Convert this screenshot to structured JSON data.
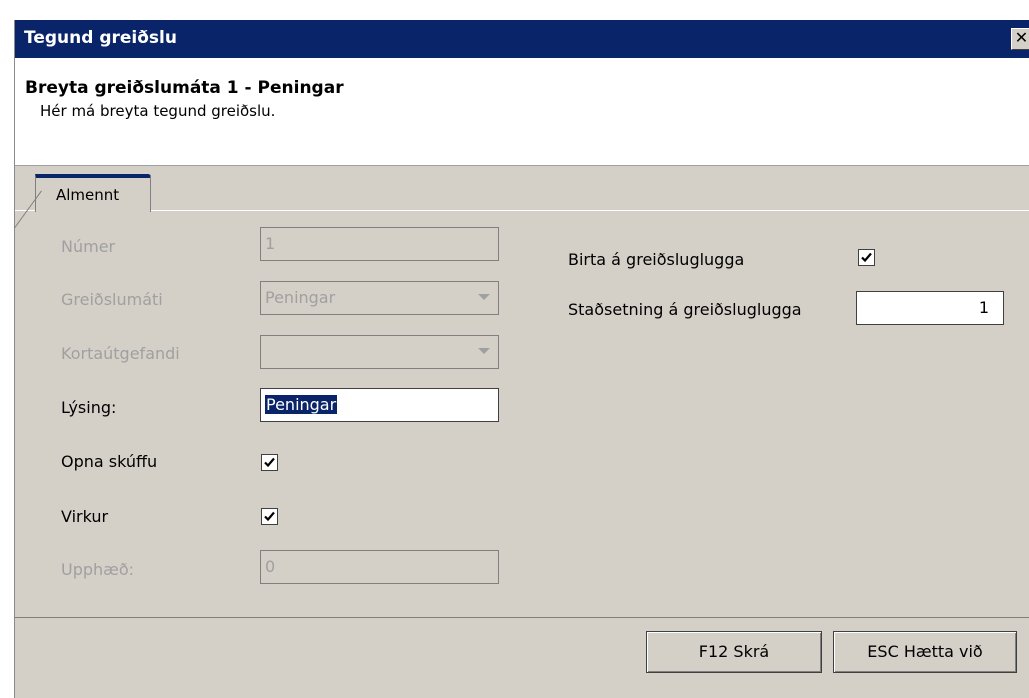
{
  "window": {
    "title": "Tegund greiðslu",
    "close_glyph": "✕"
  },
  "header": {
    "heading": "Breyta greiðslumáta 1 - Peningar",
    "subtitle": "Hér má breyta tegund greiðslu."
  },
  "tabs": [
    {
      "label": "Almennt"
    }
  ],
  "form": {
    "numer": {
      "label": "Númer",
      "value": "1"
    },
    "greidslumati": {
      "label": "Greiðslumáti",
      "value": "Peningar"
    },
    "kortautgefandi": {
      "label": "Kortaútgefandi",
      "value": ""
    },
    "lysing": {
      "label": "Lýsing:",
      "value": "Peningar"
    },
    "opna_skuffu": {
      "label": "Opna skúffu",
      "checked": true
    },
    "virkur": {
      "label": "Virkur",
      "checked": true
    },
    "upphaed": {
      "label": "Upphæð:",
      "value": "0"
    },
    "birta": {
      "label": "Birta á greiðsluglugga",
      "checked": true
    },
    "stadsetning": {
      "label": "Staðsetning á greiðsluglugga",
      "value": "1"
    }
  },
  "buttons": {
    "save": "F12  Skrá",
    "cancel": "ESC  Hætta við"
  },
  "colors": {
    "titlebar": "#0a246a",
    "panel": "#d4d0c8",
    "selection": "#0a246a"
  }
}
